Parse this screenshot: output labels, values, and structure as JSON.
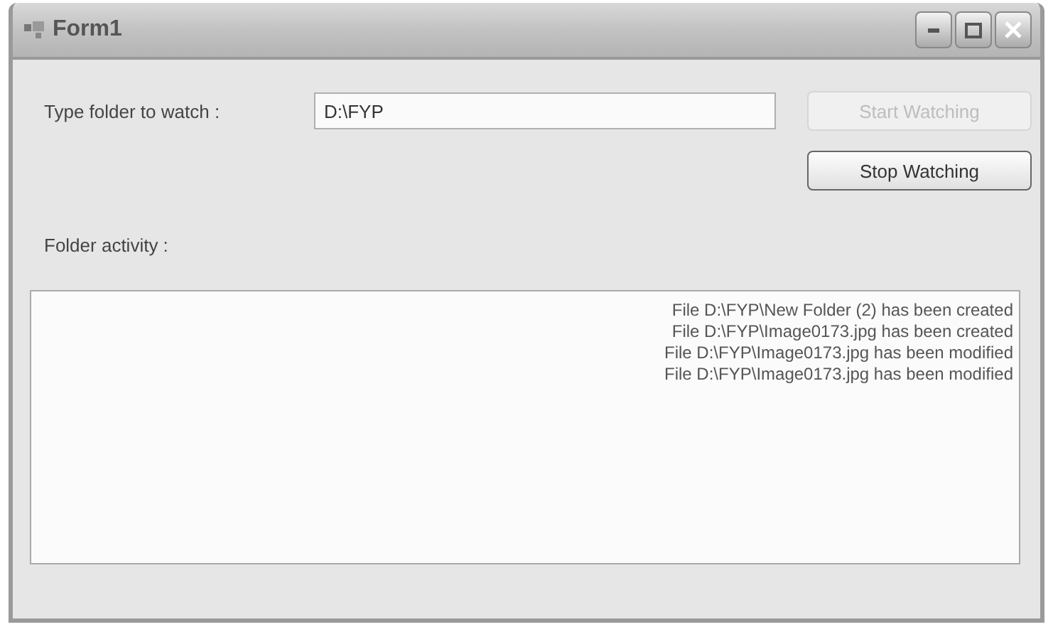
{
  "window": {
    "title": "Form1"
  },
  "watch": {
    "label": "Type folder to watch :",
    "value": "D:\\FYP"
  },
  "buttons": [
    {
      "label": "Start Watching",
      "disabled": true
    },
    {
      "label": "Stop Watching",
      "disabled": false
    }
  ],
  "activity": {
    "label": "Folder activity :",
    "lines": [
      "File D:\\FYP\\New Folder (2) has been created",
      "File D:\\FYP\\Image0173.jpg has been created",
      "File D:\\FYP\\Image0173.jpg has been modified",
      "File D:\\FYP\\Image0173.jpg has been modified"
    ]
  }
}
